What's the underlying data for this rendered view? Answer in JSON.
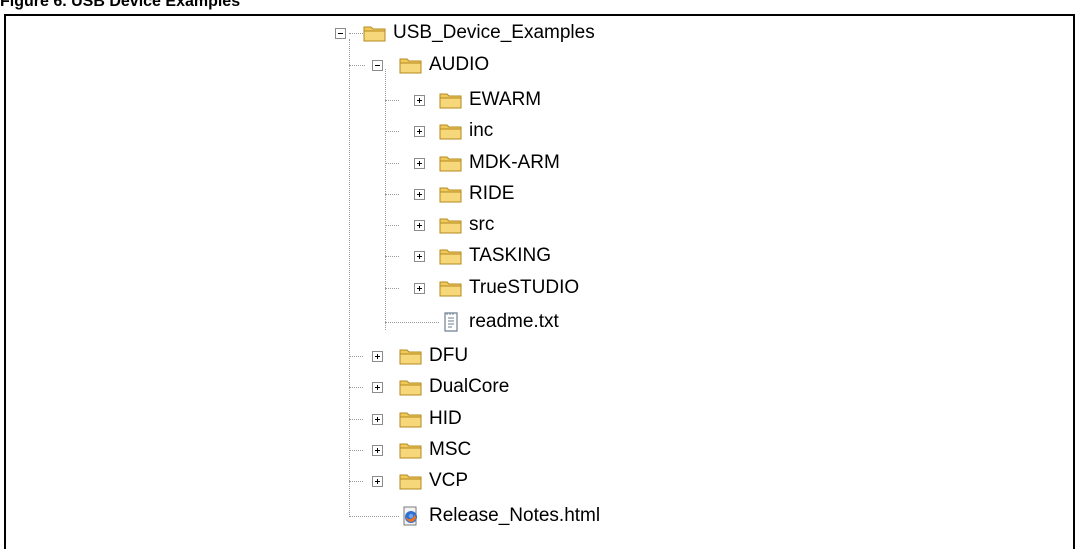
{
  "figure_caption": "Figure 6. USB Device Examples",
  "tree": {
    "root": {
      "label": "USB_Device_Examples",
      "expanded": true,
      "icon": "folder-icon"
    },
    "audio": {
      "label": "AUDIO",
      "expanded": true,
      "icon": "folder-icon",
      "children": [
        {
          "label": "EWARM",
          "icon": "folder-icon"
        },
        {
          "label": "inc",
          "icon": "folder-icon"
        },
        {
          "label": "MDK-ARM",
          "icon": "folder-icon"
        },
        {
          "label": "RIDE",
          "icon": "folder-icon"
        },
        {
          "label": "src",
          "icon": "folder-icon"
        },
        {
          "label": "TASKING",
          "icon": "folder-icon"
        },
        {
          "label": "TrueSTUDIO",
          "icon": "folder-icon"
        },
        {
          "label": "readme.txt",
          "icon": "text-file-icon"
        }
      ]
    },
    "siblings": [
      {
        "label": "DFU",
        "icon": "folder-icon"
      },
      {
        "label": "DualCore",
        "icon": "folder-icon"
      },
      {
        "label": "HID",
        "icon": "folder-icon"
      },
      {
        "label": "MSC",
        "icon": "folder-icon"
      },
      {
        "label": "VCP",
        "icon": "folder-icon"
      }
    ],
    "release_notes": {
      "label": "Release_Notes.html",
      "icon": "firefox-html-icon"
    }
  },
  "colors": {
    "folder_fill": "#f6d77a",
    "folder_tab": "#f0c95c",
    "folder_stroke": "#b58a1e",
    "tree_line": "#9a9a9a"
  }
}
